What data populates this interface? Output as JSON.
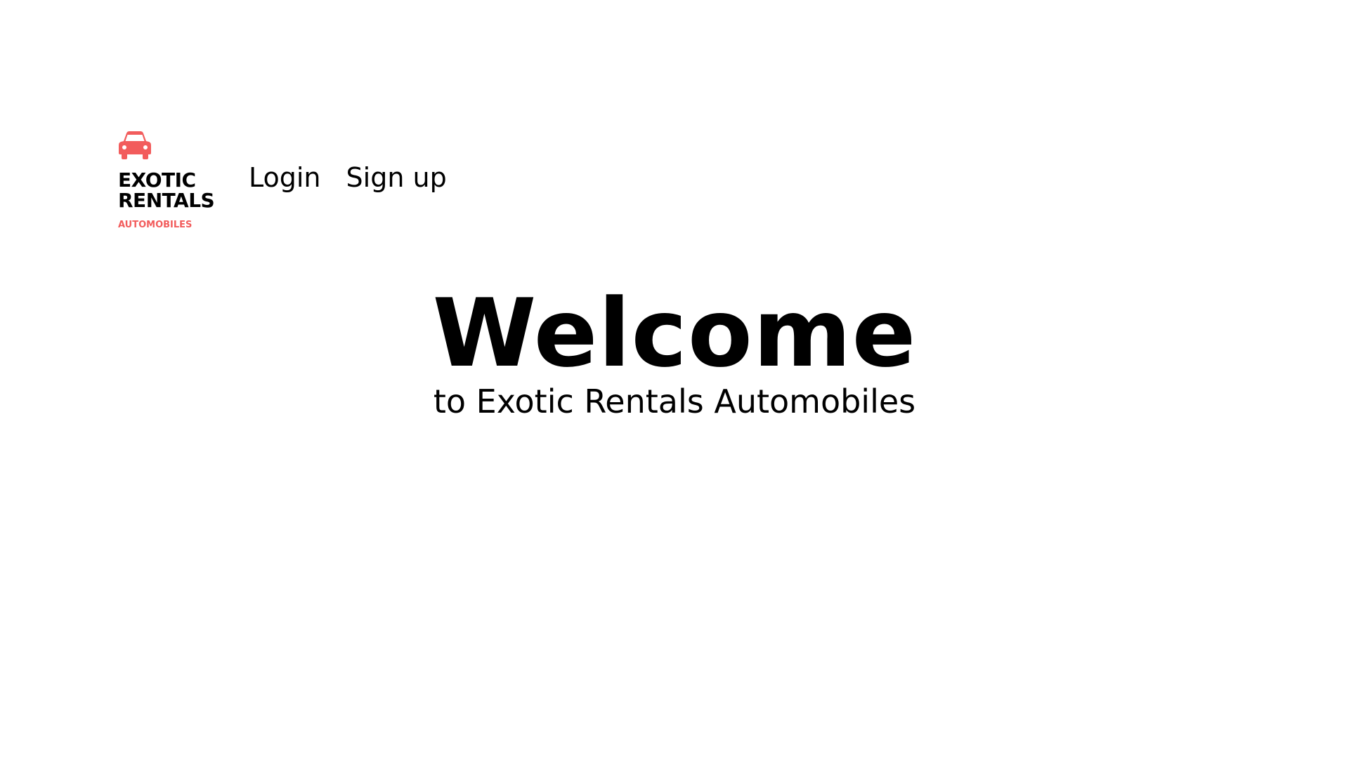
{
  "logo": {
    "icon": "car-icon",
    "line1": "EXOTIC",
    "line2": "RENTALS",
    "sub": "AUTOMOBILES",
    "accent_color": "#f25c5c"
  },
  "nav": {
    "login": "Login",
    "signup": "Sign up"
  },
  "hero": {
    "title": "Welcome",
    "subtitle": "to Exotic Rentals Automobiles"
  }
}
